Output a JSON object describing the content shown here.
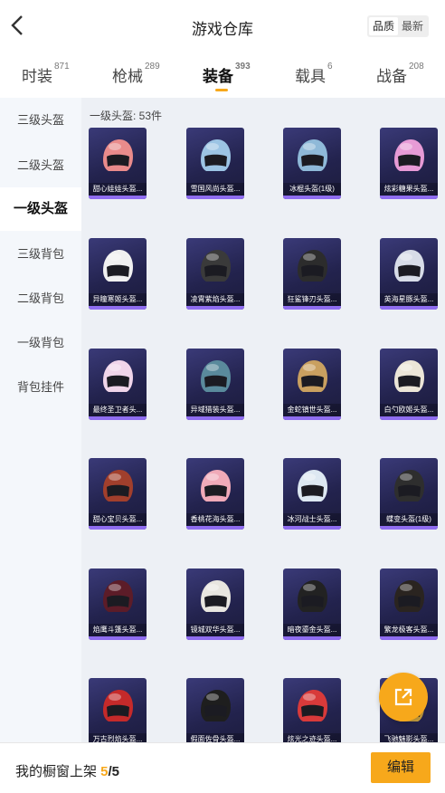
{
  "header": {
    "title": "游戏仓库",
    "sort": {
      "quality": "品质",
      "newest": "最新",
      "active": "quality"
    }
  },
  "tabs": [
    {
      "label": "时装",
      "count": "871"
    },
    {
      "label": "枪械",
      "count": "289"
    },
    {
      "label": "装备",
      "count": "393",
      "active": true
    },
    {
      "label": "载具",
      "count": "6"
    },
    {
      "label": "战备",
      "count": "208"
    }
  ],
  "sidebar": [
    {
      "label": "三级头盔"
    },
    {
      "label": "二级头盔"
    },
    {
      "label": "一级头盔",
      "active": true
    },
    {
      "label": "三级背包"
    },
    {
      "label": "二级背包"
    },
    {
      "label": "一级背包"
    },
    {
      "label": "背包挂件"
    }
  ],
  "content": {
    "category_label": "一级头盔: ",
    "category_count": "53件",
    "items": [
      {
        "name": "甜心娃娃头盔...",
        "color": "#e98b8b"
      },
      {
        "name": "雪国风尚头盔...",
        "color": "#9cc4e4"
      },
      {
        "name": "冰棍头盔(1级)",
        "color": "#8fb9d8"
      },
      {
        "name": "炫彩糖果头盔...",
        "color": "#e79bd6"
      },
      {
        "name": "异瞳寒姬头盔...",
        "color": "#f0f0f0"
      },
      {
        "name": "凌霄紫焰头盔...",
        "color": "#3a3a3a"
      },
      {
        "name": "狂鲨锋刃头盔...",
        "color": "#2c2c2c"
      },
      {
        "name": "英海星豚头盔...",
        "color": "#d8dde8"
      },
      {
        "name": "最终圣卫者头...",
        "color": "#f0d5ea"
      },
      {
        "name": "异域猎装头盔...",
        "color": "#5a8a9c"
      },
      {
        "name": "金蛇镇世头盔...",
        "color": "#c9a060"
      },
      {
        "name": "白勺欧姬头盔...",
        "color": "#ece6d8"
      },
      {
        "name": "甜心宝贝头盔...",
        "color": "#a13f2c"
      },
      {
        "name": "香桃花海头盔...",
        "color": "#f0aab8"
      },
      {
        "name": "冰河战士头盔...",
        "color": "#dde8f2"
      },
      {
        "name": "蝶变头盔(1级)",
        "color": "#2e2e2e"
      },
      {
        "name": "焰鹰斗篷头盔...",
        "color": "#5c1c28"
      },
      {
        "name": "镜城双华头盔...",
        "color": "#e8e6e0"
      },
      {
        "name": "暗夜鎏金头盔...",
        "color": "#222222"
      },
      {
        "name": "繁龙极客头盔...",
        "color": "#2a2420"
      },
      {
        "name": "万古烈焰头盔...",
        "color": "#c42a2a"
      },
      {
        "name": "假面佐骨头盔...",
        "color": "#1e1e1e"
      },
      {
        "name": "炫光之迹头盔...",
        "color": "#d83a3a"
      },
      {
        "name": "飞驰魅影头盔...",
        "color": "#c8a040"
      }
    ]
  },
  "bottom": {
    "label": "我的橱窗上架 ",
    "current": "5",
    "total": "/5",
    "edit": "编辑"
  },
  "icons": {
    "back": "chevron-left-icon",
    "share": "share-external-icon"
  },
  "colors": {
    "accent": "#f7a81b",
    "card_bg": "#2a2a5a",
    "card_bar": "#8f6df0"
  }
}
